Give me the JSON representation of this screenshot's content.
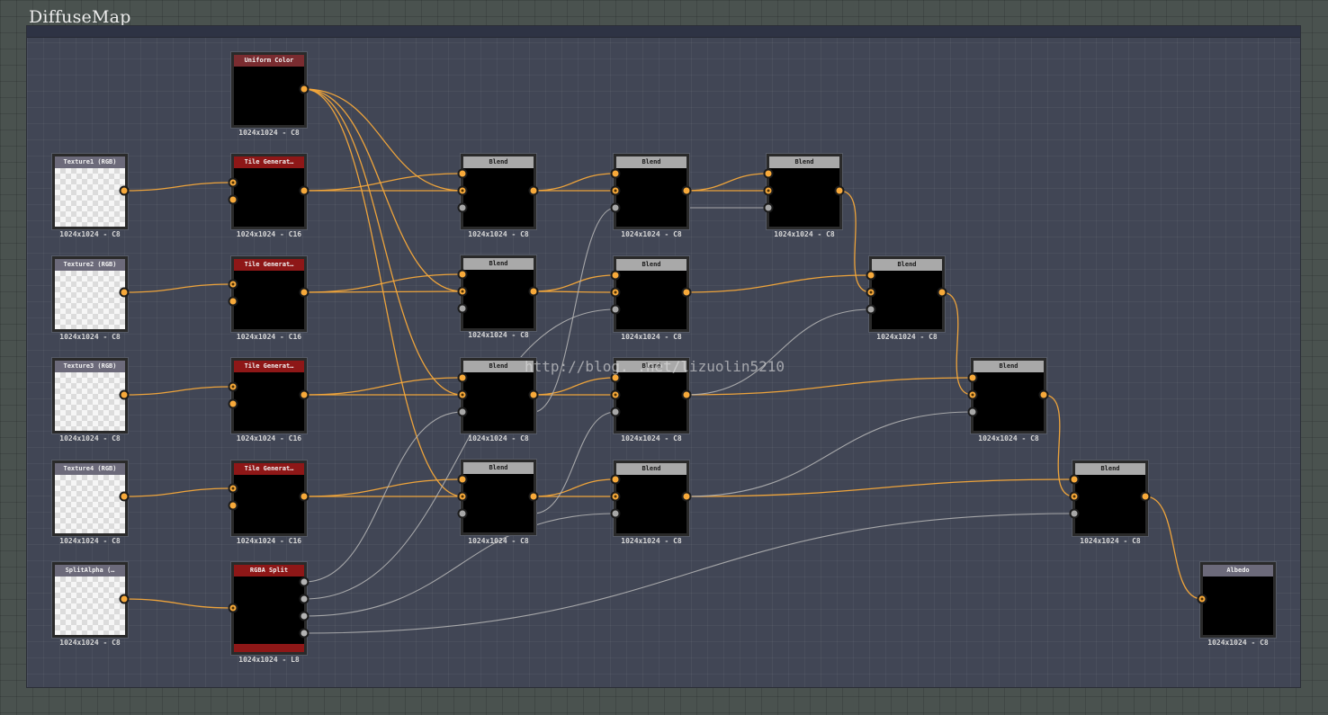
{
  "graph": {
    "title": "DiffuseMap"
  },
  "watermark": "http://blog.    .net/lizuolin5210",
  "colors": {
    "wire_color": "#f7a93a",
    "wire_gray": "#b9b9b9",
    "background": "#4a524f",
    "frame": "#414655"
  },
  "nodes": {
    "uniform": {
      "title": "Uniform Color",
      "caption": "1024x1024 - C8"
    },
    "tex1": {
      "title": "Texture1 (RGB)",
      "caption": "1024x1024 - C8"
    },
    "tex2": {
      "title": "Texture2 (RGB)",
      "caption": "1024x1024 - C8"
    },
    "tex3": {
      "title": "Texture3 (RGB)",
      "caption": "1024x1024 - C8"
    },
    "tex4": {
      "title": "Texture4 (RGB)",
      "caption": "1024x1024 - C8"
    },
    "splitalpha": {
      "title": "SplitAlpha (…",
      "caption": "1024x1024 - C8"
    },
    "tile1": {
      "title": "Tile Generat…",
      "caption": "1024x1024 - C16"
    },
    "tile2": {
      "title": "Tile Generat…",
      "caption": "1024x1024 - C16"
    },
    "tile3": {
      "title": "Tile Generat…",
      "caption": "1024x1024 - C16"
    },
    "tile4": {
      "title": "Tile Generat…",
      "caption": "1024x1024 - C16"
    },
    "rgbasplit": {
      "title": "RGBA Split",
      "caption": "1024x1024 - L8"
    },
    "b1": {
      "title": "Blend",
      "caption": "1024x1024 - C8"
    },
    "b2": {
      "title": "Blend",
      "caption": "1024x1024 - C8"
    },
    "b3": {
      "title": "Blend",
      "caption": "1024x1024 - C8"
    },
    "b4": {
      "title": "Blend",
      "caption": "1024x1024 - C8"
    },
    "b5": {
      "title": "Blend",
      "caption": "1024x1024 - C8"
    },
    "b6": {
      "title": "Blend",
      "caption": "1024x1024 - C8"
    },
    "b7": {
      "title": "Blend",
      "caption": "1024x1024 - C8"
    },
    "b8": {
      "title": "Blend",
      "caption": "1024x1024 - C8"
    },
    "b9": {
      "title": "Blend",
      "caption": "1024x1024 - C8"
    },
    "b10": {
      "title": "Blend",
      "caption": "1024x1024 - C8"
    },
    "b11": {
      "title": "Blend",
      "caption": "1024x1024 - C8"
    },
    "b12": {
      "title": "Blend",
      "caption": "1024x1024 - C8"
    },
    "albedo": {
      "title": "Albedo",
      "caption": "1024x1024 - C8"
    }
  }
}
